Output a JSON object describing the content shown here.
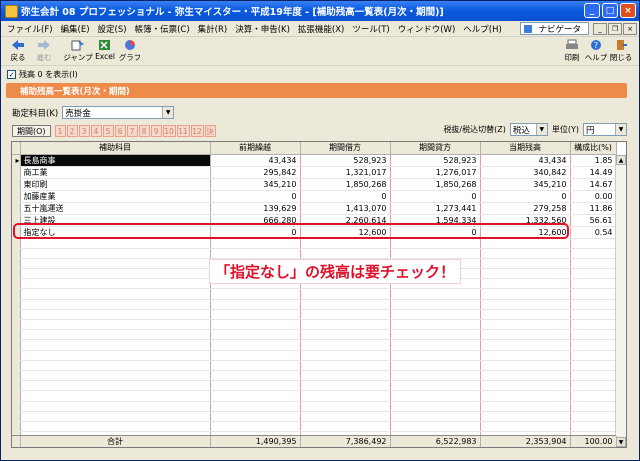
{
  "window": {
    "title": "弥生会計 08 プロフェッショナル - 弥生マイスター・平成19年度 - [補助残高一覧表(月次・期間)]"
  },
  "menu": [
    "ファイル(F)",
    "編集(E)",
    "設定(S)",
    "帳簿・伝票(C)",
    "集計(R)",
    "決算・申告(K)",
    "拡張機能(X)",
    "ツール(T)",
    "ウィンドウ(W)",
    "ヘルプ(H)"
  ],
  "navigator_label": "ナビゲータ",
  "toolbar": {
    "back": "戻る",
    "forward": "進む",
    "jump": "ジャンプ",
    "excel": "Excel",
    "graph": "グラフ",
    "print": "印刷",
    "help": "ヘルプ",
    "close": "閉じる"
  },
  "show_zero_label": "残高 0 を表示(I)",
  "panel_title": "補助残高一覧表(月次・期間)",
  "account_label": "勘定科目(K)",
  "account_value": "売掛金",
  "period_label": "期間(O)",
  "months": [
    "1",
    "2",
    "3",
    "4",
    "5",
    "6",
    "7",
    "8",
    "9",
    "10",
    "11",
    "12",
    "決"
  ],
  "tax_label": "税抜/税込切替(Z)",
  "tax_value": "税込",
  "unit_label": "単位(Y)",
  "unit_value": "円",
  "columns": [
    "補助科目",
    "前期繰越",
    "期間借方",
    "期間貸方",
    "当期残高",
    "構成比(%)"
  ],
  "rows": [
    {
      "name": "長島商事",
      "prev": "43,434",
      "debit": "528,923",
      "credit": "528,923",
      "balance": "43,434",
      "ratio": "1.85"
    },
    {
      "name": "商工業",
      "prev": "295,842",
      "debit": "1,321,017",
      "credit": "1,276,017",
      "balance": "340,842",
      "ratio": "14.49"
    },
    {
      "name": "東印刷",
      "prev": "345,210",
      "debit": "1,850,268",
      "credit": "1,850,268",
      "balance": "345,210",
      "ratio": "14.67"
    },
    {
      "name": "加藤産業",
      "prev": "0",
      "debit": "0",
      "credit": "0",
      "balance": "0",
      "ratio": "0.00"
    },
    {
      "name": "五十嵐運送",
      "prev": "139,629",
      "debit": "1,413,070",
      "credit": "1,273,441",
      "balance": "279,258",
      "ratio": "11.86"
    },
    {
      "name": "三上建設",
      "prev": "666,280",
      "debit": "2,260,614",
      "credit": "1,594,334",
      "balance": "1,332,560",
      "ratio": "56.61"
    },
    {
      "name": "指定なし",
      "prev": "0",
      "debit": "12,600",
      "credit": "0",
      "balance": "12,600",
      "ratio": "0.54"
    }
  ],
  "totals": {
    "label": "合計",
    "prev": "1,490,395",
    "debit": "7,386,492",
    "credit": "6,522,983",
    "balance": "2,353,904",
    "ratio": "100.00"
  },
  "callout": "「指定なし」の残高は要チェック！",
  "colors": {
    "title_bar": "#0a5ce0",
    "header": "#ef8b4a",
    "highlight": "#e0102a"
  }
}
